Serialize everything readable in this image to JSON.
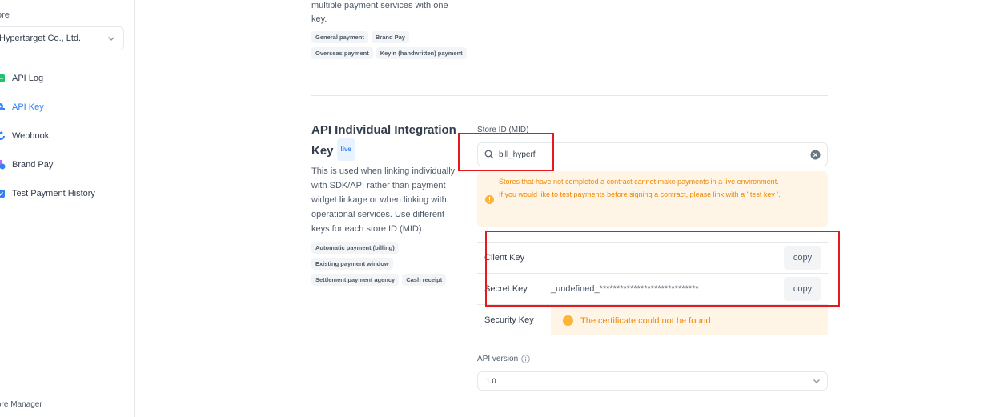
{
  "sidebar": {
    "store_label": "ore",
    "store_select": "Hypertarget Co., Ltd.",
    "items": [
      {
        "label": "API Log",
        "icon": "api-log-icon",
        "active": false
      },
      {
        "label": "API Key",
        "icon": "key-icon",
        "active": true
      },
      {
        "label": "Webhook",
        "icon": "webhook-icon",
        "active": false
      },
      {
        "label": "Brand Pay",
        "icon": "brand-pay-icon",
        "active": false
      },
      {
        "label": "Test Payment History",
        "icon": "test-payment-icon",
        "active": false
      }
    ],
    "footer": "ore Manager"
  },
  "top_section": {
    "desc_line1": "multiple payment services with one",
    "desc_line2": "key.",
    "chips_row1": [
      "General payment",
      "Brand Pay"
    ],
    "chips_row2": [
      "Overseas payment",
      "KeyIn (handwritten) payment"
    ]
  },
  "individual": {
    "title": "API Individual Integration Key",
    "badge": "live",
    "description": "This is used when linking individually with SDK/API rather than payment widget linkage or when linking with operational services. Use different keys for each store ID (MID).",
    "chips_row1": [
      "Automatic payment (billing)"
    ],
    "chips_row2": [
      "Existing payment window"
    ],
    "chips_row3": [
      "Settlement payment agency",
      "Cash receipt"
    ]
  },
  "mid": {
    "label": "Store ID (MID)",
    "value": "bill_hyperf"
  },
  "warning": {
    "line1": "Stores that have not completed a contract cannot make payments in a live environment.",
    "line2": "If you would like to test payments before signing a contract, please link with a ' test key '."
  },
  "keys": {
    "client_label": "Client Key",
    "client_value": "",
    "secret_label": "Secret Key",
    "secret_value": "_undefined_*****************************",
    "security_label": "Security Key",
    "cert_message": "The certificate could not be found",
    "copy_label": "copy"
  },
  "api_version": {
    "label": "API version",
    "value": "1.0"
  },
  "colors": {
    "accent": "#3182f6",
    "warning": "#f18600",
    "annotation": "#e8191e"
  }
}
